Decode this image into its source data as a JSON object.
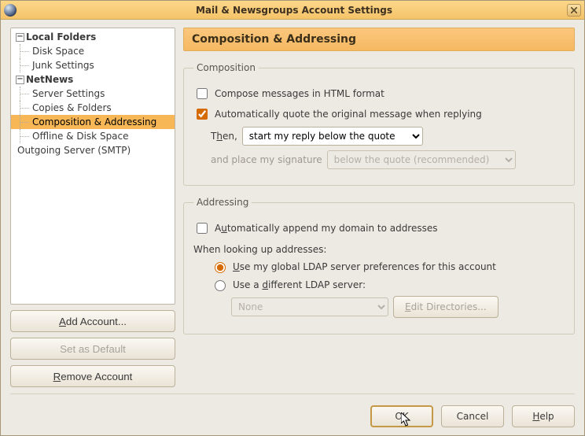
{
  "window": {
    "title": "Mail & Newsgroups Account Settings"
  },
  "tree": {
    "local_folders": {
      "label": "Local Folders"
    },
    "lf_disk_space": {
      "label": "Disk Space"
    },
    "lf_junk": {
      "label": "Junk Settings"
    },
    "netnews": {
      "label": "NetNews"
    },
    "nn_server": {
      "label": "Server Settings"
    },
    "nn_copies": {
      "label": "Copies & Folders"
    },
    "nn_comp": {
      "label": "Composition & Addressing"
    },
    "nn_offline": {
      "label": "Offline & Disk Space"
    },
    "smtp": {
      "label": "Outgoing Server (SMTP)"
    }
  },
  "left_buttons": {
    "add": "Add Account...",
    "default": "Set as Default",
    "remove": "Remove Account"
  },
  "panel": {
    "title": "Composition & Addressing"
  },
  "composition": {
    "legend": "Composition",
    "compose_html": "Compose messages in HTML format",
    "auto_quote": "Automatically quote the original message when replying",
    "then_label_pre": "T",
    "then_label_u": "h",
    "then_label_post": "en,",
    "reply_position_selected": "start my reply below the quote",
    "sig_label": "and place my signature",
    "sig_position_selected": "below the quote (recommended)"
  },
  "addressing": {
    "legend": "Addressing",
    "auto_domain_pre": "A",
    "auto_domain_u": "u",
    "auto_domain_post": "tomatically append my domain to addresses",
    "lookup_label": "When looking up addresses:",
    "radio_global_u": "U",
    "radio_global_post": "se my global LDAP server preferences for this account",
    "radio_diff_pre": "Use a ",
    "radio_diff_u": "d",
    "radio_diff_post": "ifferent LDAP server:",
    "ldap_server_selected": "None",
    "edit_dirs_u": "E",
    "edit_dirs_post": "dit Directories..."
  },
  "footer": {
    "ok": "OK",
    "cancel": "Cancel",
    "help_u": "H",
    "help_post": "elp"
  }
}
